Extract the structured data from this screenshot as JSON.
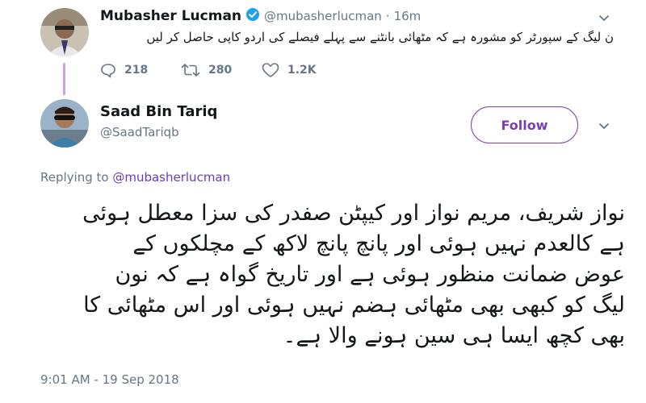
{
  "parent_tweet": {
    "author_name": "Mubasher Lucman",
    "handle": "@mubasherlucman",
    "separator": "·",
    "time": "16m",
    "text": "ن لیگ کے سپورٹر کو مشورہ ہے کہ مٹھائی بانٹنے سے پہلے فیصلے کی اردو کاپی حاصل کر لیں",
    "replies": "218",
    "retweets": "280",
    "likes": "1.2K"
  },
  "reply_tweet": {
    "author_name": "Saad Bin Tariq",
    "handle": "@SaadTariqb",
    "follow_label": "Follow",
    "replying_prefix": "Replying to ",
    "replying_handle": "@mubasherlucman",
    "text_lines": [
      "نواز شریف، مریم نواز اور کیپٹن صفدر کی سزا معطل ہوئی",
      "ہے کالعدم نہیں ہوئی اور پانچ پانچ لاکھ کے مچلکوں کے",
      "عوض ضمانت منظور ہوئی ہے اور تاریخ گواہ ہے کہ نون",
      "لیگ کو کبھی بھی مٹھائی ہضم نہیں ہوئی اور اس مٹھائی کا",
      "بھی کچھ ایسا ہی سین ہونے والا ہے۔"
    ],
    "timestamp": "9:01 AM - 19 Sep 2018"
  },
  "icons": {
    "verified": "verified-badge-icon",
    "reply": "reply-icon",
    "retweet": "retweet-icon",
    "like": "heart-icon",
    "menu": "chevron-down-icon"
  },
  "colors": {
    "accent": "#7b3fb2",
    "verified": "#1da1f2",
    "thread_line": "#c9a3e6",
    "muted": "#657786"
  }
}
